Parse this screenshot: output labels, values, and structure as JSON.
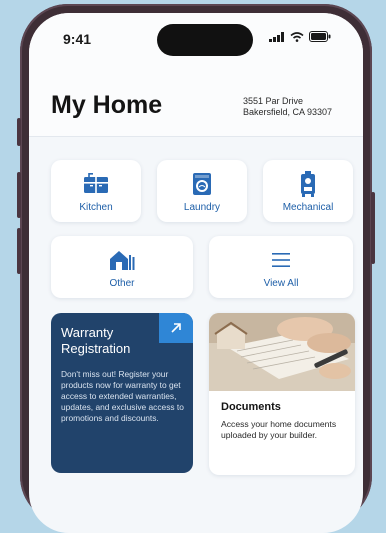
{
  "status": {
    "time": "9:41"
  },
  "header": {
    "title": "My Home",
    "address_line1": "3551 Par Drive",
    "address_line2": "Bakersfield, CA  93307"
  },
  "categories": [
    {
      "label": "Kitchen",
      "icon": "kitchen-icon"
    },
    {
      "label": "Laundry",
      "icon": "laundry-icon"
    },
    {
      "label": "Mechanical",
      "icon": "mechanical-icon"
    },
    {
      "label": "Other",
      "icon": "house-icon"
    },
    {
      "label": "View All",
      "icon": "menu-icon"
    }
  ],
  "warranty_card": {
    "title": "Warranty Registration",
    "body": "Don't miss out! Register your products now for warranty to get access to extended warranties, updates, and exclusive access to promotions and discounts."
  },
  "documents_card": {
    "title": "Documents",
    "body": "Access your home documents uploaded by your builder."
  },
  "colors": {
    "background": "#b5d6e8",
    "accent": "#1e5fa8",
    "warranty_card": "#21436b",
    "warranty_arrow": "#2f86d6"
  }
}
